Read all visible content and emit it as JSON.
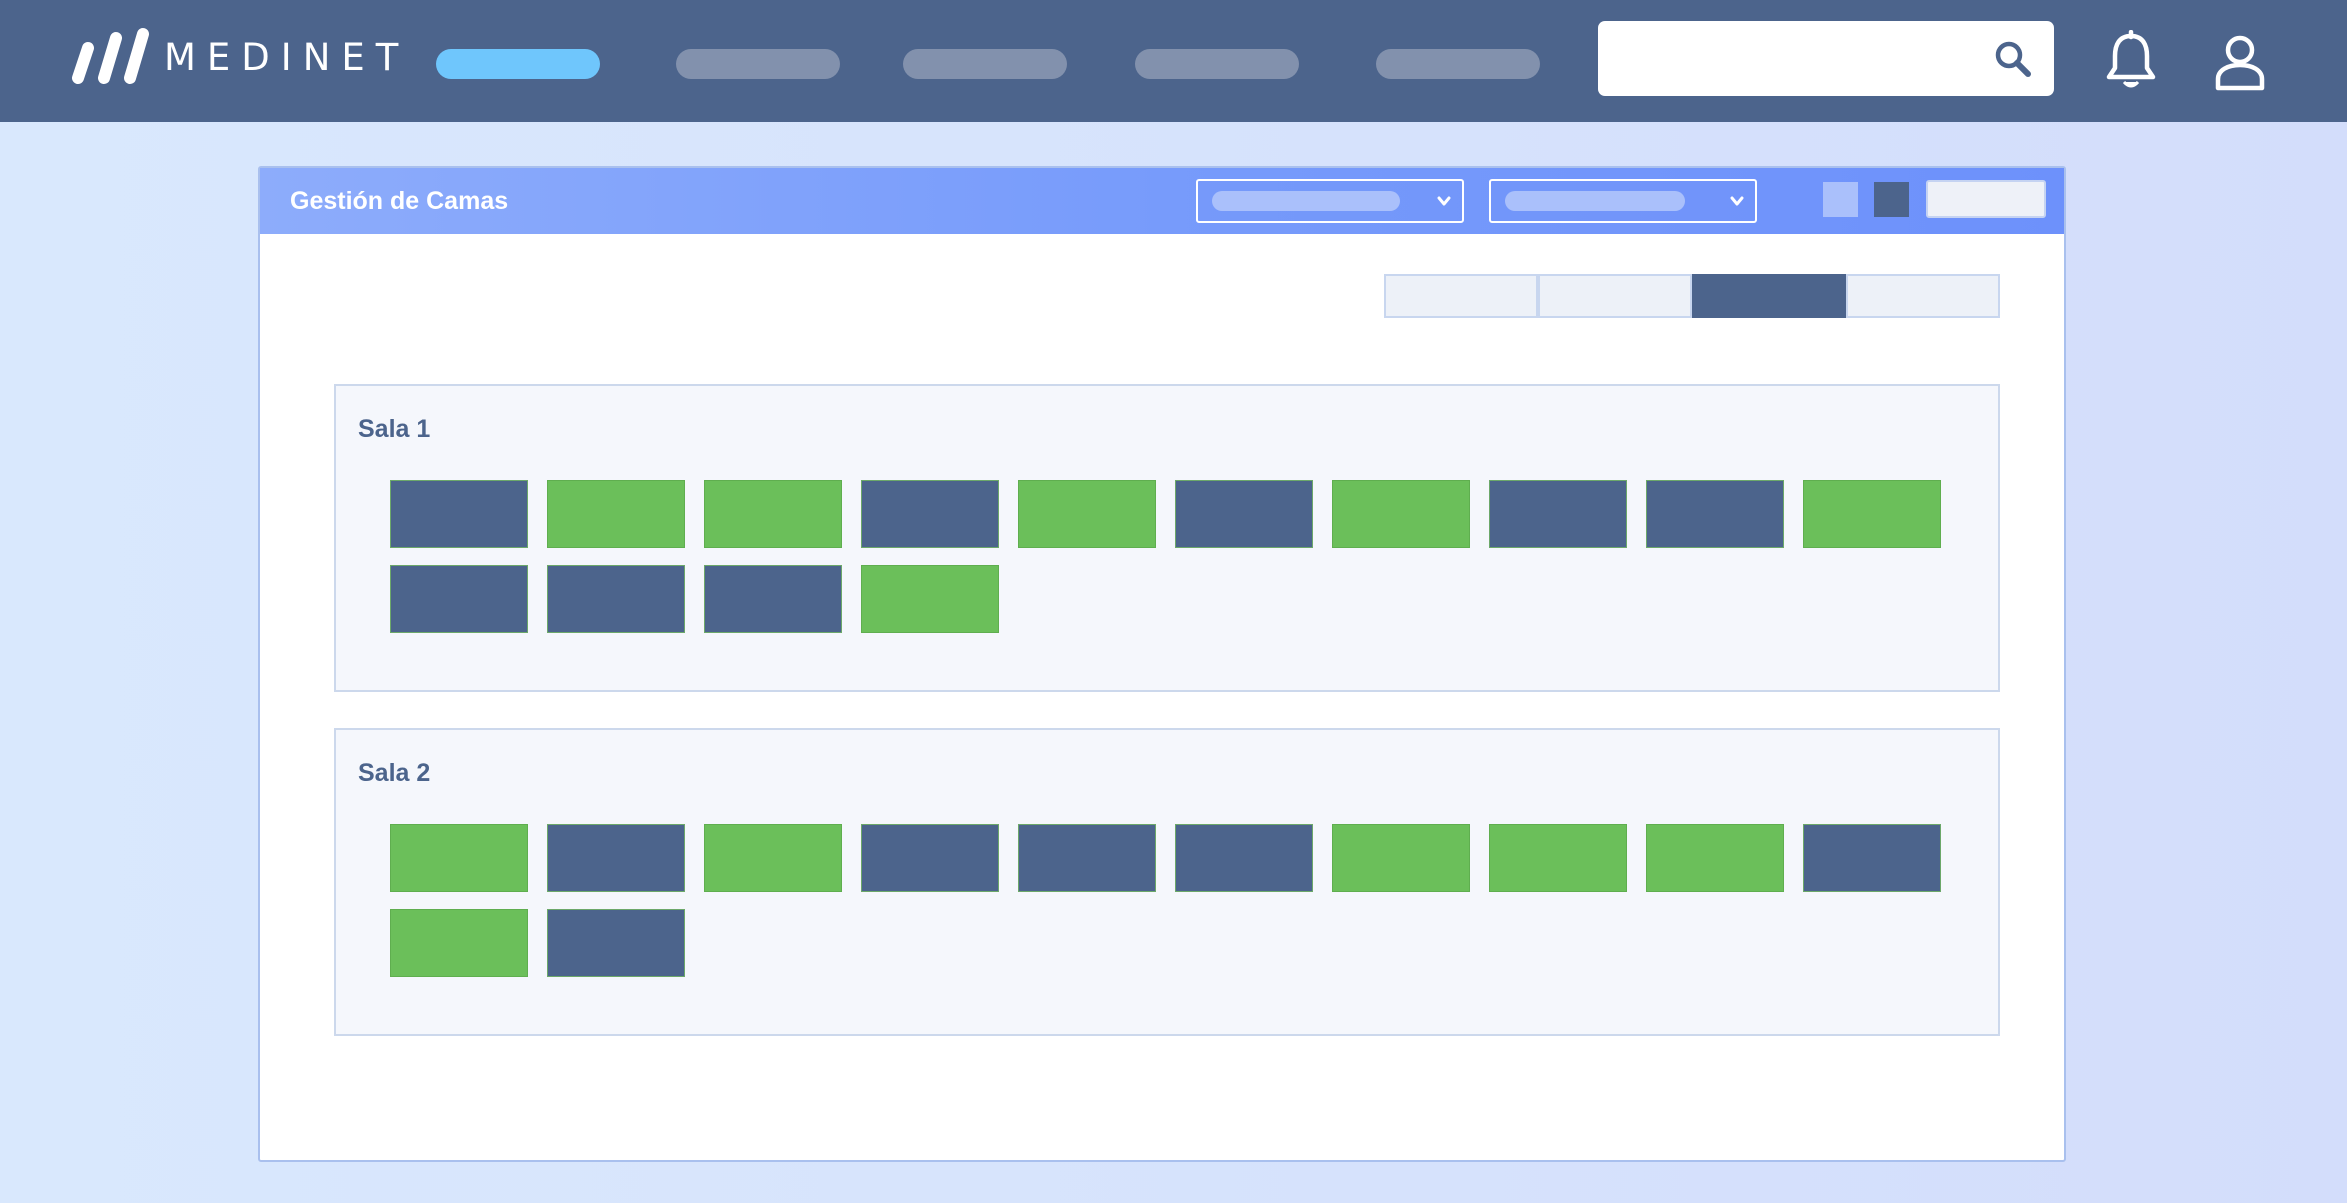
{
  "app": {
    "brand": "MEDINET"
  },
  "colors": {
    "nav": "#4c648c",
    "nav_active": "#6fc6fc",
    "bed_occupied": "#4c648c",
    "bed_free": "#6bbf5a",
    "header_gradient_start": "#8dacfb",
    "header_gradient_end": "#6d91fb"
  },
  "nav": {
    "items": [
      {
        "state": "active"
      },
      {
        "state": "inactive"
      },
      {
        "state": "inactive"
      },
      {
        "state": "inactive"
      },
      {
        "state": "inactive"
      }
    ]
  },
  "search": {
    "value": "",
    "placeholder": "",
    "icon": "search-icon"
  },
  "icons": {
    "notifications": "bell-icon",
    "account": "user-icon"
  },
  "panel": {
    "title": "Gestión de Camas",
    "filters": [
      {
        "selected": ""
      },
      {
        "selected": ""
      }
    ],
    "view_toggle": {
      "selected_index": 2,
      "count": 4
    }
  },
  "rooms": [
    {
      "name": "Sala 1",
      "beds": [
        "ocupada",
        "libre",
        "libre",
        "ocupada",
        "libre",
        "ocupada",
        "libre",
        "ocupada",
        "ocupada",
        "libre",
        "ocupada",
        "ocupada",
        "ocupada",
        "libre"
      ]
    },
    {
      "name": "Sala 2",
      "beds": [
        "libre",
        "ocupada",
        "libre",
        "ocupada",
        "ocupada",
        "ocupada",
        "libre",
        "libre",
        "libre",
        "ocupada",
        "libre",
        "ocupada"
      ]
    }
  ]
}
